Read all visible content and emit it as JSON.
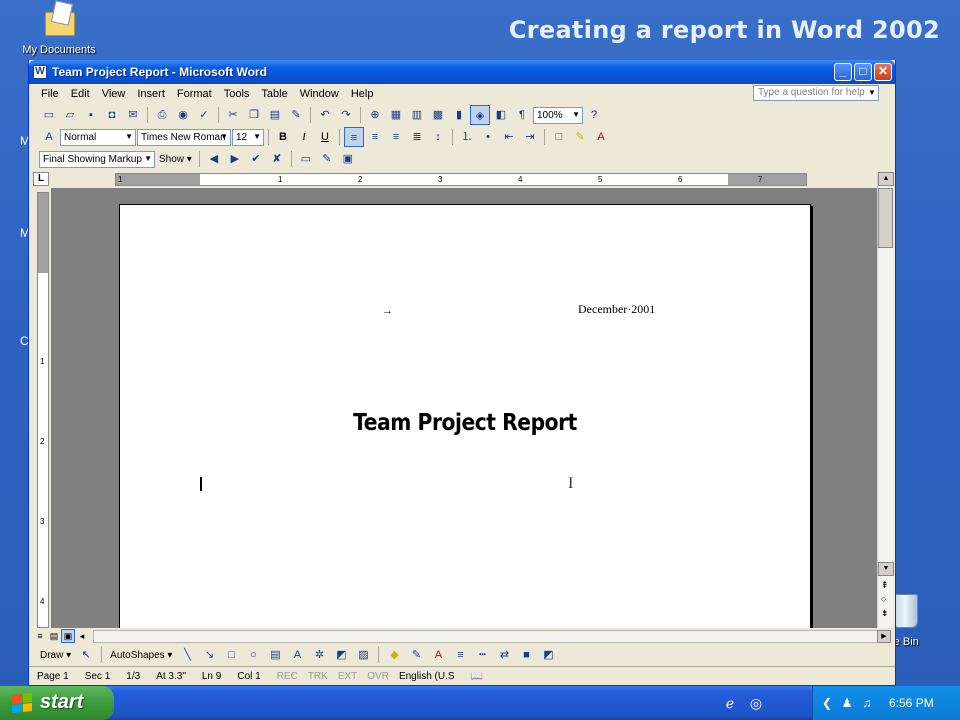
{
  "slide": {
    "title": "Creating a report in Word 2002"
  },
  "desktop": {
    "my_documents_label": "My Documents",
    "recycle_bin_label": "le Bin"
  },
  "window": {
    "title": "Team Project Report - Microsoft Word",
    "app_icon_letter": "W",
    "controls": {
      "minimize": "_",
      "maximize": "□",
      "close": "✕"
    }
  },
  "menu": {
    "items": [
      "File",
      "Edit",
      "View",
      "Insert",
      "Format",
      "Tools",
      "Table",
      "Window",
      "Help"
    ],
    "help_placeholder": "Type a question for help"
  },
  "standard_toolbar": {
    "zoom": "100%"
  },
  "formatting_toolbar": {
    "style": "Normal",
    "font": "Times New Roman",
    "size": "12"
  },
  "reviewing_toolbar": {
    "display": "Final Showing Markup",
    "show_label": "Show"
  },
  "ruler": {
    "numbers": [
      "1",
      "1",
      "2",
      "3",
      "4",
      "5",
      "6",
      "7"
    ],
    "corner": "L",
    "vertical_numbers": [
      "1",
      "2",
      "3",
      "4"
    ]
  },
  "document": {
    "date": "December·2001",
    "title": "Team Project Report",
    "tab_mark": "→"
  },
  "drawing_toolbar": {
    "draw_label": "Draw",
    "autoshapes_label": "AutoShapes"
  },
  "status_bar": {
    "page": "Page 1",
    "section": "Sec 1",
    "page_of": "1/3",
    "at": "At 3.3\"",
    "line": "Ln 9",
    "col": "Col 1",
    "rec": "REC",
    "trk": "TRK",
    "ext": "EXT",
    "ovr": "OVR",
    "language": "English (U.S"
  },
  "taskbar": {
    "start_label": "start",
    "clock": "6:56 PM"
  },
  "colors": {
    "titlebar_blue": "#0553d4",
    "window_face": "#ece9d8",
    "start_green": "#3c9a3c",
    "desktop_blue": "#2f63c2"
  }
}
